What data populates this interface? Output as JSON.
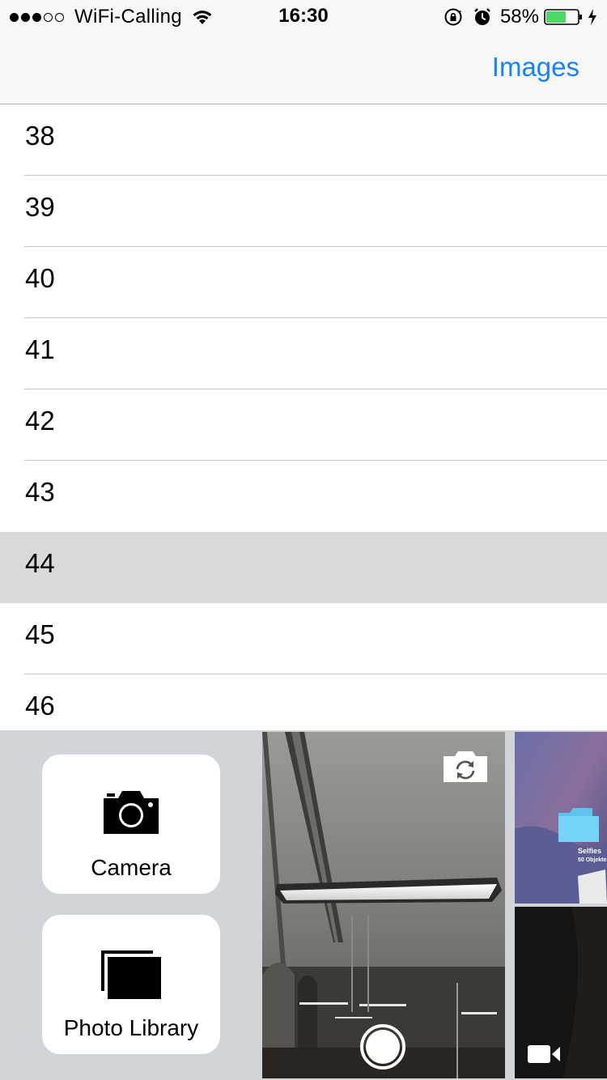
{
  "status_bar": {
    "carrier": "WiFi-Calling",
    "time": "16:30",
    "battery_percent": "58%",
    "signal_full": 3,
    "signal_total": 5
  },
  "nav": {
    "right_button": "Images"
  },
  "rows": [
    {
      "label": "38",
      "selected": false
    },
    {
      "label": "39",
      "selected": false
    },
    {
      "label": "40",
      "selected": false
    },
    {
      "label": "41",
      "selected": false
    },
    {
      "label": "42",
      "selected": false
    },
    {
      "label": "43",
      "selected": false
    },
    {
      "label": "44",
      "selected": true
    },
    {
      "label": "45",
      "selected": false
    },
    {
      "label": "46",
      "selected": false
    }
  ],
  "attach_panel": {
    "camera_label": "Camera",
    "library_label": "Photo Library",
    "thumb_caption_1": "Selfies",
    "thumb_caption_2": "50 Objekte"
  },
  "colors": {
    "accent": "#1a82f7",
    "battery": "#4cd964",
    "selected_row": "#d9d9d9",
    "panel_bg": "#d1d4d9"
  }
}
